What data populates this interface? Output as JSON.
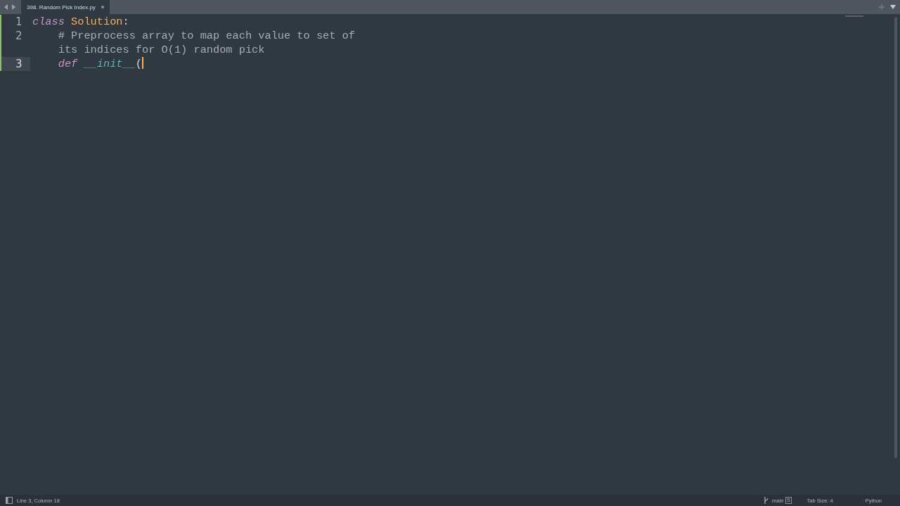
{
  "tabs": [
    {
      "label": "398. Random Pick Index.py",
      "selected": true,
      "modified": true
    }
  ],
  "editor": {
    "lines": [
      {
        "number": "1",
        "selected": false,
        "tokens": [
          {
            "kind": "keyword",
            "text": "class "
          },
          {
            "kind": "classname",
            "text": "Solution"
          },
          {
            "kind": "punct",
            "text": ":"
          }
        ],
        "children": [
          {
            "number": "2",
            "selected": false,
            "tokens": [
              {
                "kind": "comment",
                "text": "# Preprocess array to map each value to set of its indices for O(1) random pick"
              }
            ]
          },
          {
            "number": "3",
            "selected": true,
            "tokens": [
              {
                "kind": "keyword",
                "text": "def "
              },
              {
                "kind": "dunder",
                "text": "__init__"
              },
              {
                "kind": "punct",
                "text": "("
              }
            ]
          }
        ]
      }
    ]
  },
  "status_bar": {
    "position": "Line 3, Column 18",
    "branch": "main",
    "branch_count": "5",
    "tab_size": "Tab Size: 4",
    "syntax": "Python"
  }
}
